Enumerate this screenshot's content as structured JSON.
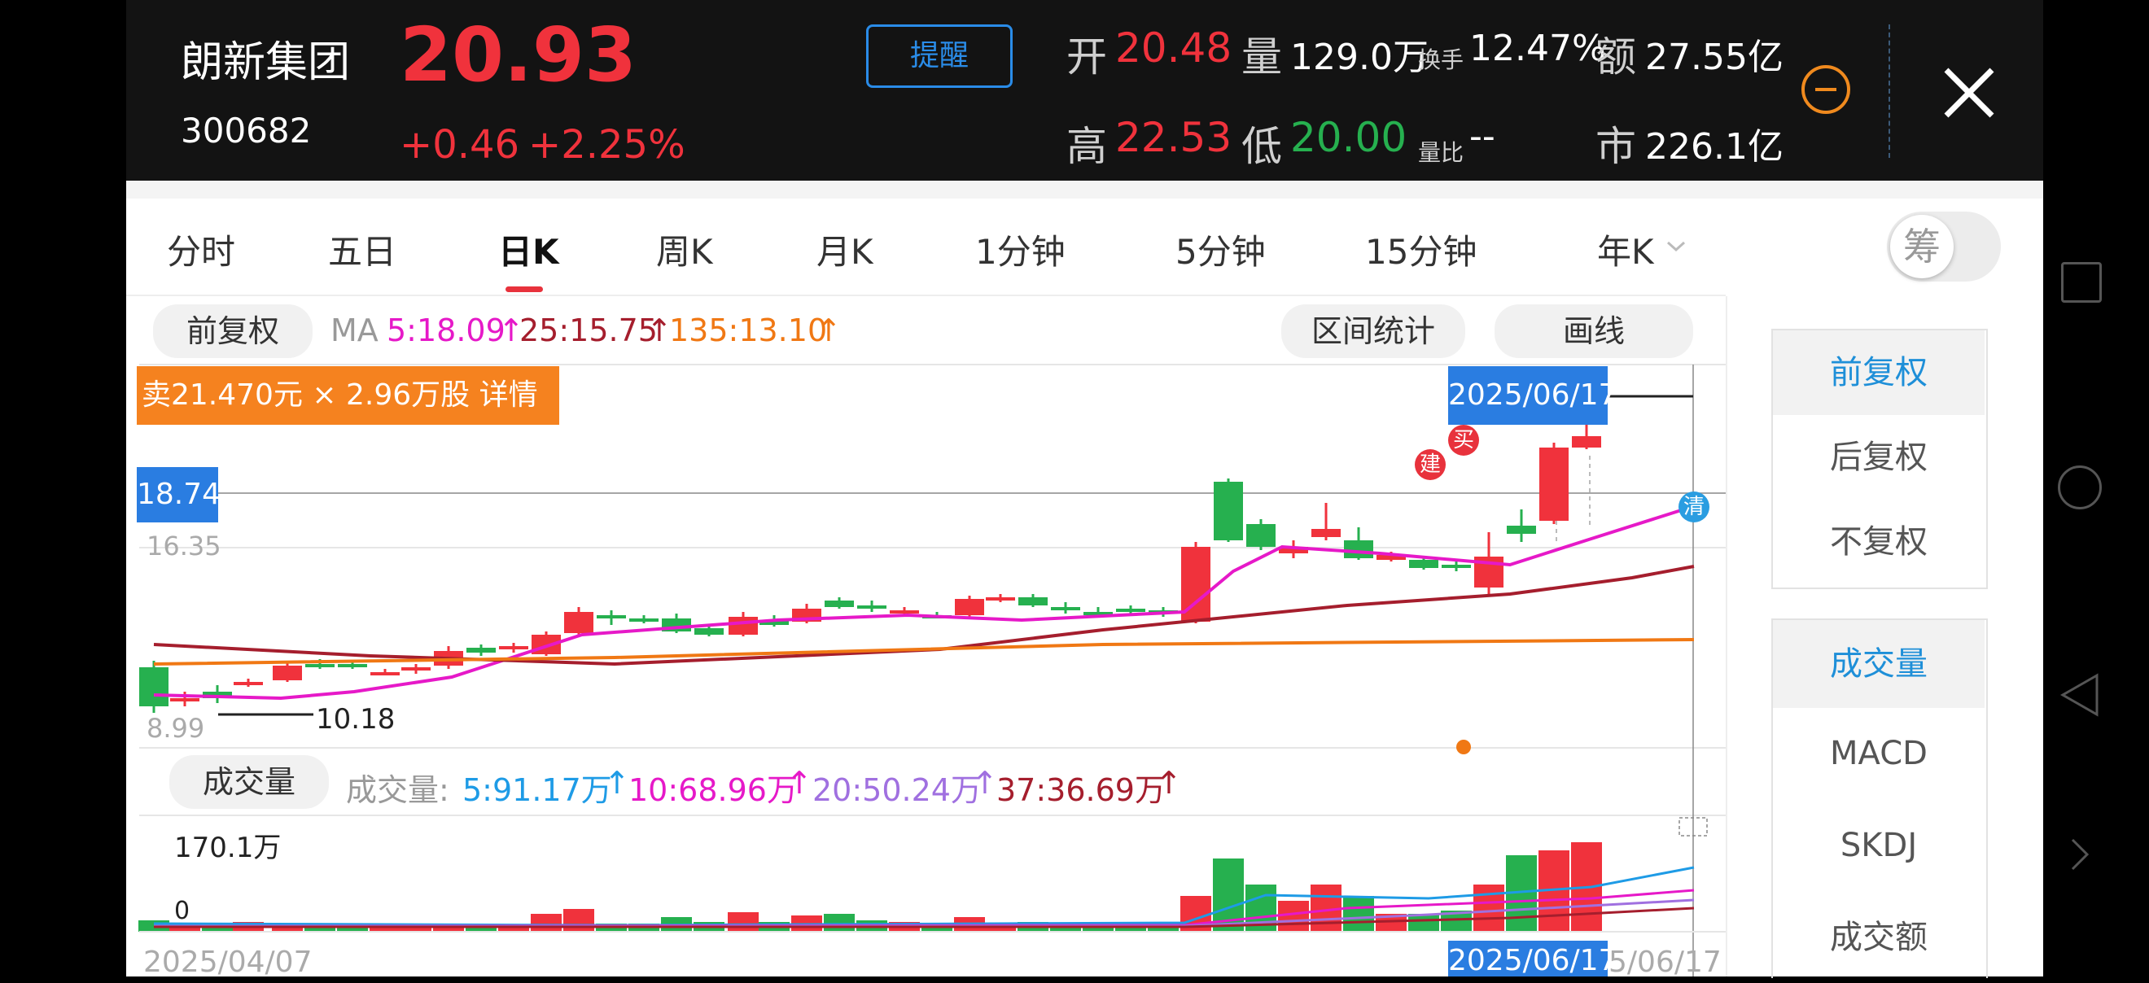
{
  "header": {
    "stock_name": "朗新集团",
    "stock_code": "300682",
    "price": "20.93",
    "change": "+0.46",
    "change_pct": "+2.25%",
    "alert_button": "提醒",
    "open_label": "开",
    "open": "20.48",
    "volume_label": "量",
    "volume": "129.0万",
    "turnover_label": "换手",
    "turnover": "12.47%",
    "amount_label": "额",
    "amount": "27.55亿",
    "high_label": "高",
    "high": "22.53",
    "low_label": "低",
    "low": "20.00",
    "vol_ratio_label": "量比",
    "vol_ratio": "--",
    "mcap_label": "市",
    "mcap": "226.1亿"
  },
  "tabs": [
    "分时",
    "五日",
    "日K",
    "周K",
    "月K",
    "1分钟",
    "5分钟",
    "15分钟",
    "年K"
  ],
  "active_tab": "日K",
  "chip_toggle": "筹",
  "toolbar": {
    "adjust": "前复权",
    "ma_label": "MA",
    "ma5": "5:18.09",
    "ma25": "25:15.75",
    "ma135": "135:13.10",
    "range_stats": "区间统计",
    "draw_line": "画线"
  },
  "kline": {
    "sell_banner": "卖21.470元 × 2.96万股 详情",
    "date_tag": "2025/06/17",
    "cross_price": "18.74",
    "level_top": "16.35",
    "level_bottom": "8.99",
    "low_mark": "10.18",
    "marker_jian": "建",
    "marker_mai": "买",
    "marker_qing": "清"
  },
  "volume": {
    "label": "成交量",
    "legend_prefix": "成交量:",
    "v5": "5:91.17万",
    "v10": "10:68.96万",
    "v20": "20:50.24万",
    "v37": "37:36.69万",
    "max": "170.1万",
    "zero": "0"
  },
  "dates": {
    "start": "2025/04/07",
    "cross": "2025/06/17",
    "end": "5/06/17"
  },
  "side": {
    "adjust_options": [
      "前复权",
      "后复权",
      "不复权"
    ],
    "indicator_options": [
      "成交量",
      "MACD",
      "SKDJ",
      "成交额"
    ]
  },
  "colors": {
    "up": "#f0323c",
    "down": "#26b04f",
    "ma5": "#e619c8",
    "ma25": "#a51e2d",
    "ma135": "#f07814",
    "accent": "#2a7de1"
  }
}
